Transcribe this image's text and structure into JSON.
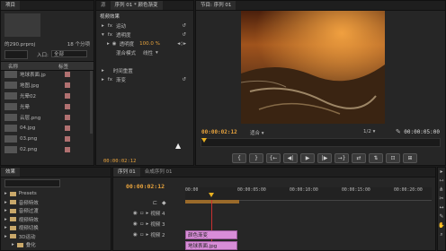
{
  "project": {
    "search_placeholder": "",
    "item_count": "的290.prproj",
    "items_label": "18 个分项",
    "entry_label": "入口:",
    "entry_value": "全部",
    "col_name": "名称",
    "col_tag": "标签",
    "items": [
      {
        "name": "地球表面.jp",
        "swatch": "#b07070"
      },
      {
        "name": "地图.jpg",
        "swatch": "#b07070"
      },
      {
        "name": "光晕02",
        "swatch": "#b07070"
      },
      {
        "name": "光晕",
        "swatch": "#b07070"
      },
      {
        "name": "云层.png",
        "swatch": "#b07070"
      },
      {
        "name": "04.jpg",
        "swatch": "#b07070"
      },
      {
        "name": "03.png",
        "swatch": "#b07070"
      },
      {
        "name": "02.png",
        "swatch": "#b07070"
      }
    ]
  },
  "effect_controls": {
    "tab": "序列 01 * 颜色渐变",
    "section": "视频效果",
    "motion": "运动",
    "opacity": "透明度",
    "opacity_label": "透明度",
    "opacity_value": "100.0 %",
    "blend_label": "混合模式",
    "blend_value": "线性",
    "time_remap": "时间重置",
    "effect": "渐变",
    "timecode": "00:00:02:12"
  },
  "program": {
    "tab": "节目: 序列 01",
    "timecode_left": "00:00:02:12",
    "fit": "适合",
    "ratio": "1/2",
    "timecode_right": "00:00:05:00",
    "transport": [
      "{",
      "}",
      "{←",
      "◀|",
      "▶",
      "|▶",
      "→}",
      "⇄",
      "⇅",
      "⊡",
      "⊞"
    ]
  },
  "effects_panel": {
    "tab": "效果",
    "tree": [
      {
        "label": "Presets",
        "indent": 0
      },
      {
        "label": "音频特效",
        "indent": 0
      },
      {
        "label": "音频过渡",
        "indent": 0
      },
      {
        "label": "视频特效",
        "indent": 0
      },
      {
        "label": "视频切换",
        "indent": 0
      },
      {
        "label": "3D运动",
        "indent": 0
      },
      {
        "label": "叠化",
        "indent": 1
      }
    ]
  },
  "timeline": {
    "tabs": [
      "序列 01",
      "合成序列 01"
    ],
    "timecode": "00:00:02:12",
    "ruler": [
      "00:00",
      "00:00:05:00",
      "00:00:10:00",
      "00:00:15:00",
      "00:00:20:00"
    ],
    "tracks": [
      "视频 4",
      "视频 3",
      "视频 2"
    ],
    "clips": [
      {
        "label": "颜色渐变",
        "color": "#d88dd8"
      },
      {
        "label": "地球表面.jpg",
        "color": "#d88dd8"
      }
    ]
  }
}
